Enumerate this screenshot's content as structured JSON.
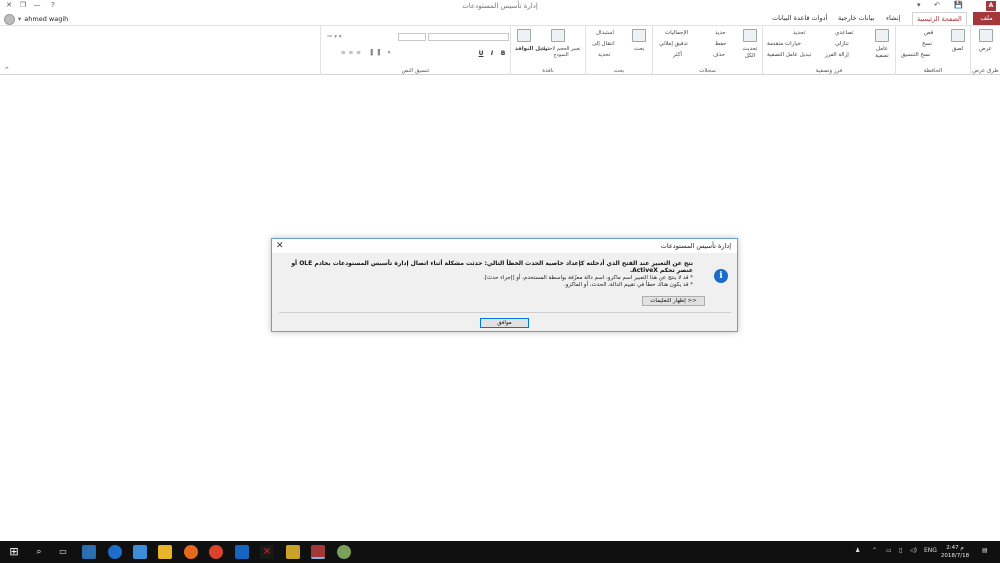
{
  "window": {
    "title": "إدارة تأسيس المستودعات",
    "controls": {
      "close": "✕",
      "restore": "❐",
      "minimize": "—",
      "help": "?"
    }
  },
  "qat": {
    "save": "💾",
    "undo": "↶",
    "more": "▾"
  },
  "user": {
    "name": "ahmed wagih"
  },
  "tabs": [
    {
      "label": "ملف"
    },
    {
      "label": "الصفحة الرئيسية"
    },
    {
      "label": "إنشاء"
    },
    {
      "label": "بيانات خارجية"
    },
    {
      "label": "أدوات قاعدة البيانات"
    }
  ],
  "ribbon": {
    "views": {
      "group": "طرق عرض",
      "btn": "عرض"
    },
    "clipboard": {
      "group": "الحافظة",
      "paste": "لصق",
      "cut": "قص",
      "copy": "نسخ",
      "painter": "نسخ التنسيق"
    },
    "sort": {
      "group": "فرز وتصفية",
      "filter": "عامل تصفية",
      "asc": "تصاعدي",
      "desc": "تنازلي",
      "remove": "إزالة الفرز",
      "selection": "تحديد",
      "advanced": "خيارات متقدمة",
      "toggle": "تبديل عامل التصفية"
    },
    "records": {
      "group": "سجلات",
      "refresh": "تحديث الكل",
      "new": "جديد",
      "save": "حفظ",
      "delete": "حذف",
      "totals": "الإجماليات",
      "spelling": "تدقيق إملائي",
      "more": "أكثر"
    },
    "find": {
      "group": "بحث",
      "find": "بحث",
      "replace": "استبدال",
      "goto": "انتقال إلى",
      "select": "تحديد"
    },
    "window": {
      "group": "نافذة",
      "fit": "تغيير الحجم لاحتواء النموذج",
      "switch": "تبديل النوافذ"
    },
    "text": {
      "group": "تنسيق النص",
      "bold": "B",
      "italic": "I",
      "underline": "U"
    }
  },
  "dialog": {
    "title": "إدارة تأسيس المستودعات",
    "close": "✕",
    "message": "نتج عن التعبير عند الفتح الذي أدخلته كإعداد خاصية الحدث الخطأ التالي: حدثت مشكلة أثناء اتصال إدارة تأسيس المستودعات بخادم OLE أو عنصر تحكم ActiveX.",
    "bullets": [
      "* قد لا ينتج عن هذا التعبير اسم ماكرو، اسم دالة معرّفة بواسطة المستخدم، أو [إجراء حدث].",
      "* قد يكون هناك خطأ في تقييم الدالة، الحدث، أو الماكرو."
    ],
    "info_icon": "i",
    "details_button": "إظهار التعليمات >>",
    "ok_button": "موافق"
  },
  "taskbar": {
    "lang": "ENG",
    "time": "2:47 م",
    "date": "2018/7/18"
  },
  "colors": {
    "accent": "#a4373a",
    "dialog_border": "#6a9fd4",
    "info": "#1a6cc5",
    "taskbar": "#101010"
  }
}
